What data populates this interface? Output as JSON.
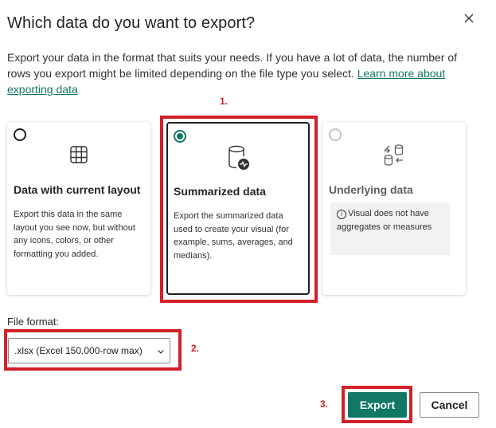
{
  "dialog": {
    "title": "Which data do you want to export?",
    "description": "Export your data in the format that suits your needs. If you have a lot of data, the number of rows you export might be limited depending on the file type you select.",
    "learn_more": "Learn more about exporting data",
    "close_icon": "close-icon"
  },
  "options": [
    {
      "title": "Data with current layout",
      "body": "Export this data in the same layout you see now, but without any icons, colors, or other formatting you added.",
      "icon": "table-grid-icon",
      "selected": false,
      "disabled": false
    },
    {
      "title": "Summarized data",
      "body": "Export the summarized data used to create your visual (for example, sums, averages, and medians).",
      "icon": "database-pulse-icon",
      "selected": true,
      "disabled": false
    },
    {
      "title": "Underlying data",
      "info": "Visual does not have aggregates or measures",
      "icon": "database-arrows-icon",
      "selected": false,
      "disabled": true
    }
  ],
  "file_format": {
    "label": "File format:",
    "value": ".xlsx (Excel 150,000-row max)"
  },
  "buttons": {
    "export": "Export",
    "cancel": "Cancel"
  },
  "annotations": {
    "step1": "1.",
    "step2": "2.",
    "step3": "3."
  },
  "colors": {
    "accent": "#117865",
    "annotation": "#d32029",
    "info_background": "#f3f2f1"
  }
}
